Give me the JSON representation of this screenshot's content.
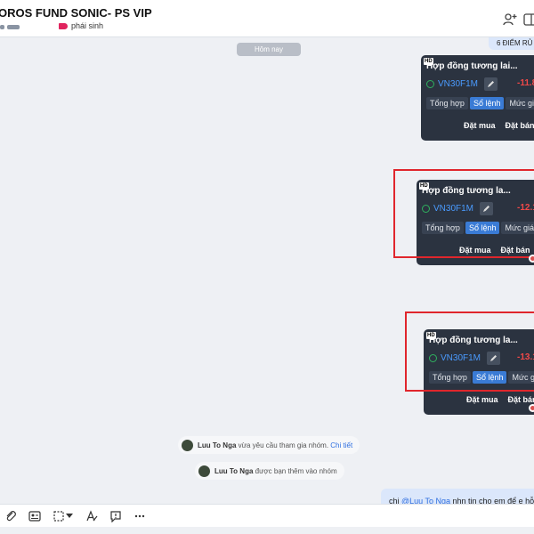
{
  "header": {
    "title": "OROS FUND SONIC- PS VIP",
    "tag_label": "phái sinh"
  },
  "chat": {
    "date_separator": "Hôm nay",
    "prev_message": "6 ĐIỂM RỦ",
    "cards": [
      {
        "badge": "HD",
        "title": "Hợp đồng tương lai...",
        "symbol": "VN30F1M",
        "price": "-11.8",
        "tabs": [
          "Tổng hợp",
          "Sổ lệnh",
          "Mức giá"
        ],
        "active_tab": 1,
        "buy_label": "Đặt mua",
        "sell_label": "Đặt bán"
      },
      {
        "badge": "HD",
        "title": "Hợp đồng tương la...",
        "symbol": "VN30F1M",
        "price": "-12.1",
        "tabs": [
          "Tổng hợp",
          "Sổ lệnh",
          "Mức giá"
        ],
        "active_tab": 1,
        "buy_label": "Đặt mua",
        "sell_label": "Đặt bán"
      },
      {
        "badge": "HD",
        "title": "Hợp đồng tương la...",
        "symbol": "VN30F1M",
        "price": "-13.1",
        "tabs": [
          "Tổng hợp",
          "Sổ lệnh",
          "Mức giá"
        ],
        "active_tab": 1,
        "buy_label": "Đặt mua",
        "sell_label": "Đặt bán"
      }
    ],
    "system_messages": [
      {
        "name": "Luu To Nga",
        "text": " vừa yêu cầu tham gia nhóm.",
        "link": "Chi tiết"
      },
      {
        "name": "Luu To Nga",
        "text": " được bạn thêm vào nhóm",
        "link": ""
      }
    ],
    "last_message": {
      "prefix": "chị ",
      "mention": "@Luu To Nga",
      "text": " nhn tin cho em để e hỗ"
    }
  },
  "toolbar": {
    "icons": [
      "paperclip-icon",
      "business-card-icon",
      "screenshot-icon",
      "chevron-down-icon",
      "text-format-icon",
      "quick-message-icon",
      "more-icon"
    ]
  },
  "colors": {
    "card_bg": "#2b3340",
    "price_negative": "#f04848",
    "active_tab": "#3a7bd5",
    "symbol": "#4a9bff",
    "highlight_box": "#e0262c",
    "mention": "#2f6fe0"
  }
}
